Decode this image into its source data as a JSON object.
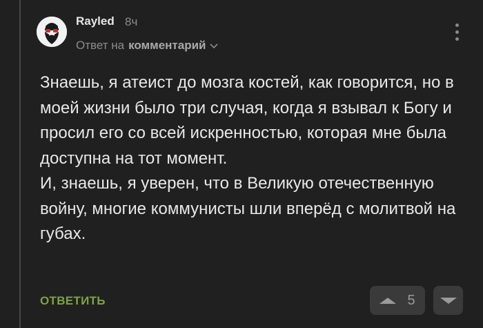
{
  "comment": {
    "author": "Rayled",
    "time": "8ч",
    "reply_prefix": "Ответ на",
    "reply_target": "комментарий",
    "paragraphs": [
      "Знаешь, я атеист до мозга костей, как говорится, но в моей жизни было три случая, когда я взывал к Богу и просил его со всей искренностью, которая мне была доступна на тот момент.",
      "И, знаешь, я уверен, что в Великую отечественную войну, многие коммунисты шли вперёд с молитвой на губах."
    ],
    "reply_label": "ОТВЕТИТЬ",
    "rating": "5"
  },
  "icons": {
    "avatar": "bearded-man-sunglasses-avatar",
    "reply_target_toggle": "chevron-down-icon",
    "menu": "kebab-menu-icon",
    "upvote": "upvote-arrow-icon",
    "downvote": "downvote-arrow-icon"
  },
  "colors": {
    "background": "#202020",
    "text": "#e8e8e8",
    "muted": "#8c8c8c",
    "accent_reply": "#7da441",
    "vote_button": "#3a3a3a"
  }
}
